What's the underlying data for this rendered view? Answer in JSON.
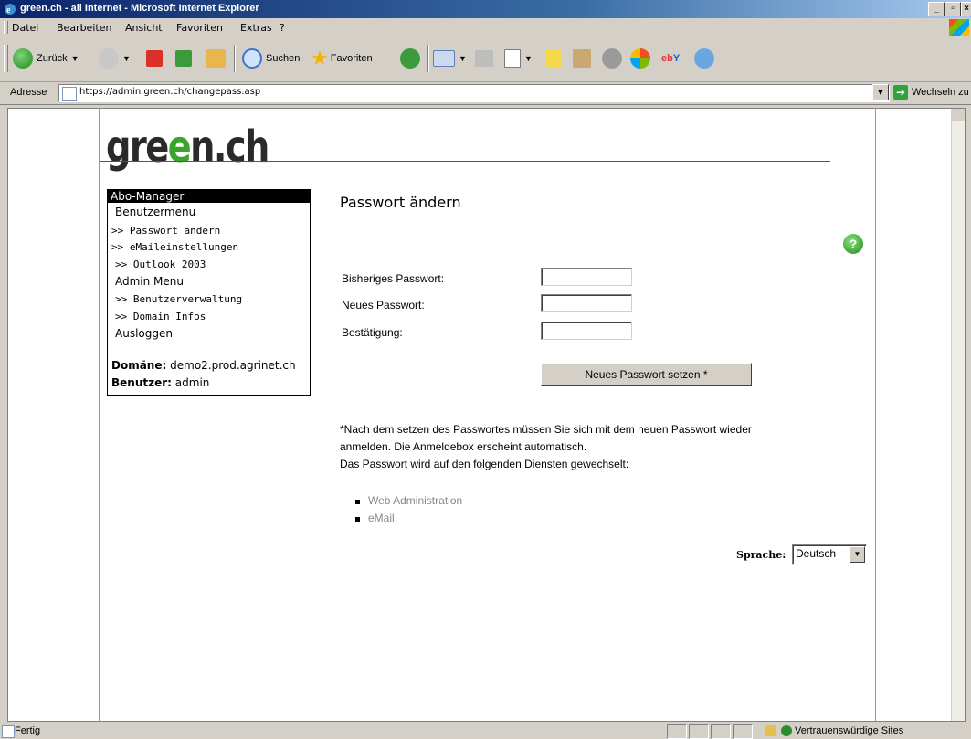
{
  "window": {
    "title": "green.ch - all Internet - Microsoft Internet Explorer"
  },
  "menu": {
    "items": [
      "Datei",
      "Bearbeiten",
      "Ansicht",
      "Favoriten",
      "Extras",
      "?"
    ]
  },
  "toolbar": {
    "back_label": "Zurück",
    "search_label": "Suchen",
    "favorites_label": "Favoriten"
  },
  "address": {
    "label": "Adresse",
    "url": "https://admin.green.ch/changepass.asp",
    "go_label": "Wechseln zu"
  },
  "logo": {
    "part1": "gre",
    "part2": "e",
    "part3": "n.ch"
  },
  "sidebar": {
    "header": "Abo-Manager",
    "user_menu": "Benutzermenu",
    "change_password": ">> Passwort ändern",
    "email_settings": ">> eMaileinstellungen",
    "outlook": ">> Outlook 2003",
    "admin_menu": "Admin Menu",
    "user_admin": ">> Benutzerverwaltung",
    "domain_info": ">> Domain Infos",
    "logout": "Ausloggen",
    "domain_label": "Domäne:",
    "domain_value": "demo2.prod.agrinet.ch",
    "user_label": "Benutzer:",
    "user_value": "admin"
  },
  "content": {
    "title": "Passwort ändern",
    "help_icon_text": "?",
    "old_password_label": "Bisheriges Passwort:",
    "new_password_label": "Neues Passwort:",
    "confirm_label": "Bestätigung:",
    "submit_label": "Neues Passwort setzen *",
    "note_line1": "*Nach dem setzen des Passwortes müssen Sie sich mit dem neuen Passwort wieder",
    "note_line2": "anmelden. Die Anmeldebox erscheint automatisch.",
    "note_line3": "Das Passwort wird auf den folgenden Diensten gewechselt:",
    "services": [
      "Web Administration",
      "eMail"
    ],
    "language_label": "Sprache:",
    "language_value": "Deutsch"
  },
  "status": {
    "text": "Fertig",
    "zone": "Vertrauenswürdige Sites"
  },
  "colors": {
    "brand_green": "#3aa52d",
    "titlebar": "#0a246a"
  }
}
